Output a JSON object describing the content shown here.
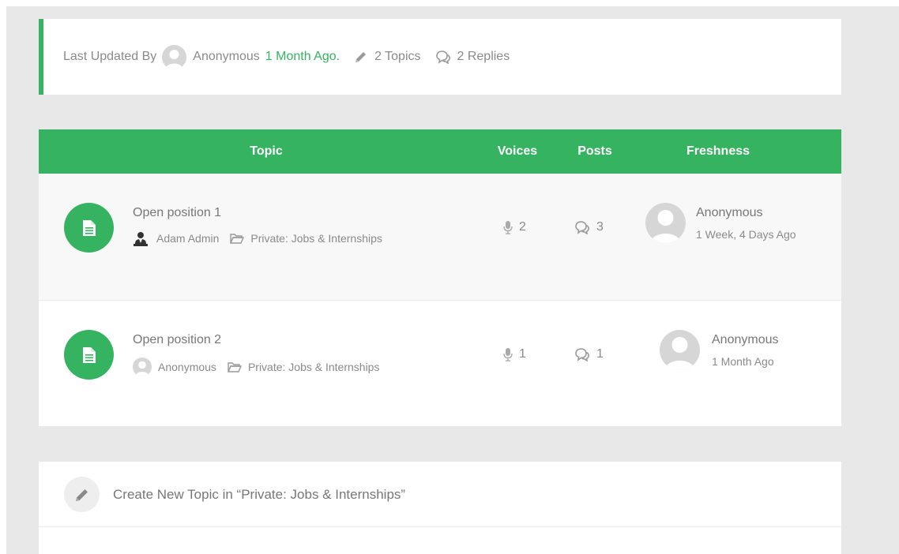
{
  "info_bar": {
    "last_updated_label": "Last Updated By",
    "user": "Anonymous",
    "time": "1 Month Ago.",
    "topics": "2 Topics",
    "replies": "2 Replies"
  },
  "table": {
    "headers": {
      "topic": "Topic",
      "voices": "Voices",
      "posts": "Posts",
      "freshness": "Freshness"
    },
    "rows": [
      {
        "title": "Open position 1",
        "author": "Adam Admin",
        "forum": "Private: Jobs & Internships",
        "voices": "2",
        "posts": "3",
        "fresh_user": "Anonymous",
        "fresh_time": "1 Week, 4 Days Ago"
      },
      {
        "title": "Open position 2",
        "author": "Anonymous",
        "forum": "Private: Jobs & Internships",
        "voices": "1",
        "posts": "1",
        "fresh_user": "Anonymous",
        "fresh_time": "1 Month Ago"
      }
    ]
  },
  "create_topic": {
    "label": "Create New Topic in “Private: Jobs & Internships”"
  },
  "icons": {
    "topic": "document-icon",
    "author_admin": "admin-user-icon",
    "author_anon": "avatar-icon",
    "forum": "folder-icon",
    "voices": "microphone-icon",
    "posts": "comments-icon",
    "topics": "pencil-icon",
    "replies": "comments-icon",
    "create": "pencil-icon"
  },
  "colors": {
    "accent": "#36b360",
    "background": "#e8e8e8",
    "text": "#777777"
  }
}
